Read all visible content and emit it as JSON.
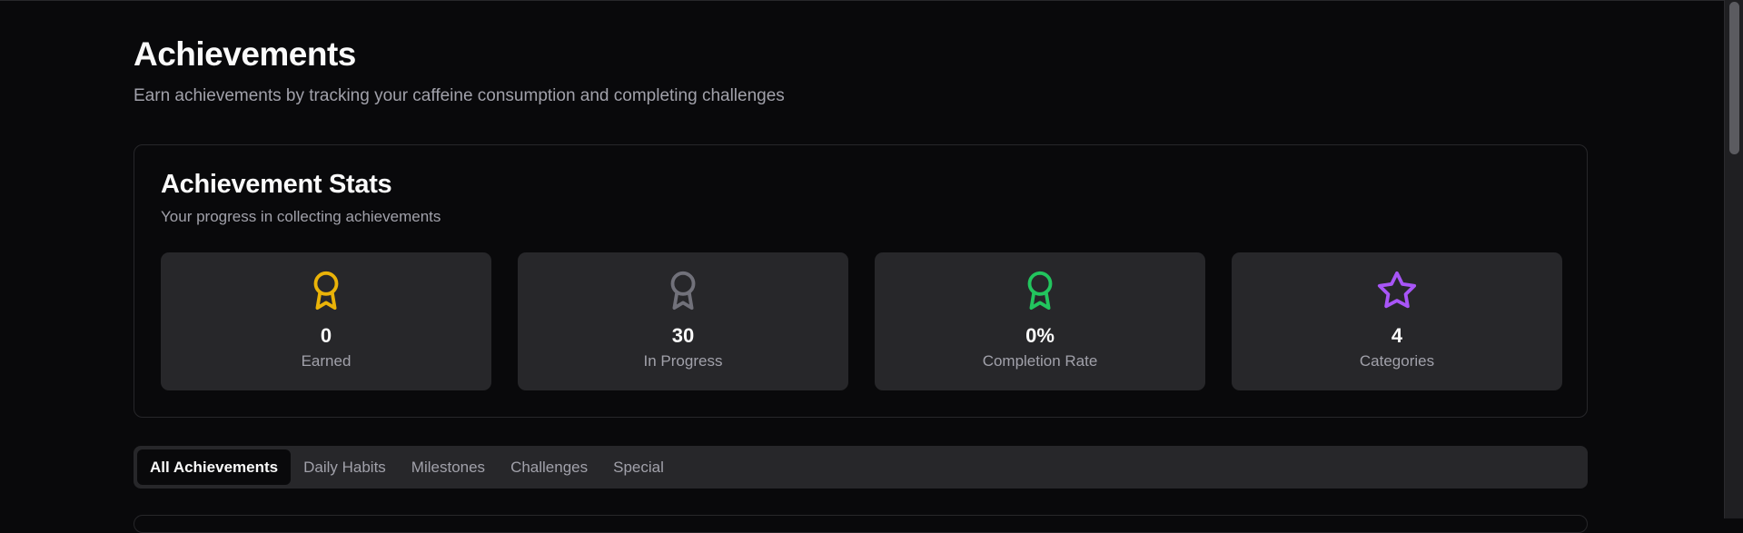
{
  "page": {
    "title": "Achievements",
    "subtitle": "Earn achievements by tracking your caffeine consumption and completing challenges"
  },
  "stats": {
    "title": "Achievement Stats",
    "subtitle": "Your progress in collecting achievements",
    "tiles": [
      {
        "value": "0",
        "label": "Earned",
        "icon": "award-icon",
        "color": "#eab308"
      },
      {
        "value": "30",
        "label": "In Progress",
        "icon": "award-icon",
        "color": "#71717a"
      },
      {
        "value": "0%",
        "label": "Completion Rate",
        "icon": "award-icon",
        "color": "#22c55e"
      },
      {
        "value": "4",
        "label": "Categories",
        "icon": "star-icon",
        "color": "#a855f7"
      }
    ]
  },
  "tabs": [
    {
      "label": "All Achievements",
      "active": true
    },
    {
      "label": "Daily Habits",
      "active": false
    },
    {
      "label": "Milestones",
      "active": false
    },
    {
      "label": "Challenges",
      "active": false
    },
    {
      "label": "Special",
      "active": false
    }
  ]
}
